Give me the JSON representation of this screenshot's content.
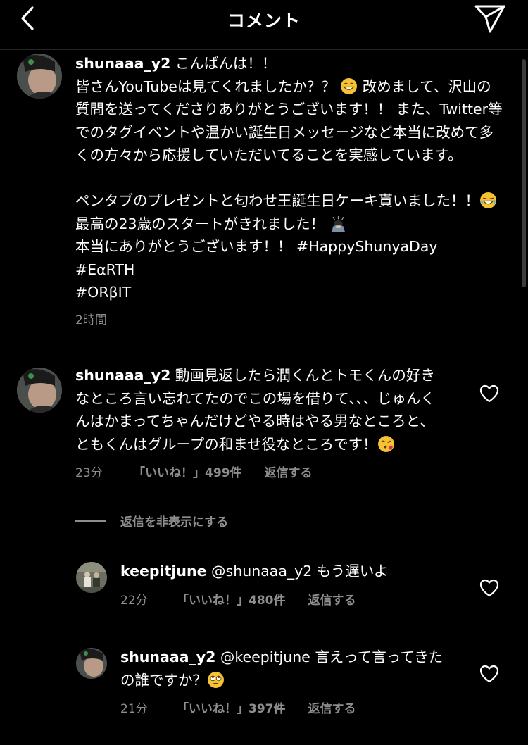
{
  "header": {
    "title": "コメント",
    "back_icon": "chevron-left-icon",
    "share_icon": "paper-plane-icon"
  },
  "caption": {
    "username": "shunaaa_y2",
    "line1": " こんばんは！！",
    "p1a": "皆さんYouTubeは見てくれましたか？？",
    "p1b": " 改めまして、沢山の質問を送ってくださりありがとうございます！！ また、Twitter等でのタグイベントや温かい誕生日メッセージなど本当に改めて多くの方々から応援していただいてることを実感しています。",
    "p2a": "ペンタブのプレゼントと匂わせ王誕生日ケーキ貰いました！！",
    "p2b": " 最高の23歳のスタートがきれました！",
    "p2c": "本当にありがとうございます！！ #HappyShunyaDay",
    "tag1": "#EαRTH",
    "tag2": "#ORβIT",
    "time": "2時間"
  },
  "comments": [
    {
      "username": "shunaaa_y2",
      "text_a": " 動画見返したら潤くんとトモくんの好きなところ言い忘れてたのでこの場を借りて、、、じゅんくんはかまってちゃんだけどやる時はやる男なところと、ともくんはグループの和ませ役なところです！",
      "time": "23分",
      "likes": "「いいね！」499件",
      "reply": "返信する"
    }
  ],
  "replies_toggle": "返信を非表示にする",
  "replies": [
    {
      "username": "keepitjune",
      "text": " @shunaaa_y2 もう遅いよ",
      "time": "22分",
      "likes": "「いいね！」480件",
      "reply": "返信する"
    },
    {
      "username": "shunaaa_y2",
      "text": " @keepitjune 言えって言ってきたの誰ですか？",
      "time": "21分",
      "likes": "「いいね！」397件",
      "reply": "返信する"
    }
  ],
  "colors": {
    "background": "#000000",
    "text": "#ffffff",
    "meta": "#8e8e8e",
    "divider": "#262626"
  }
}
